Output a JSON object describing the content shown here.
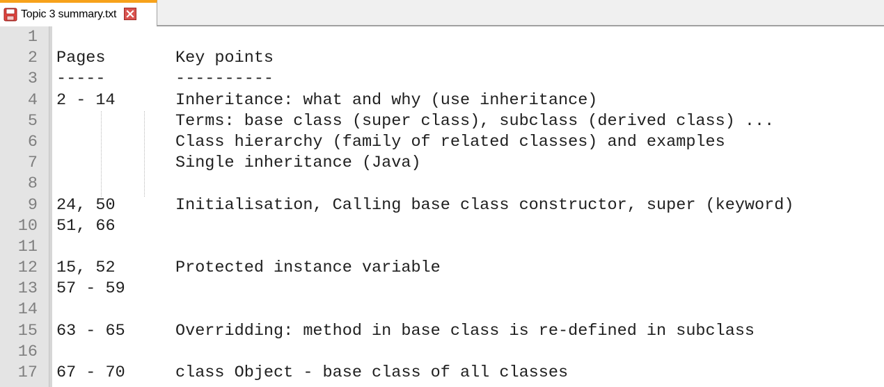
{
  "tab": {
    "title": "Topic 3 summary.txt",
    "icon": "floppy-disk-icon",
    "close_icon": "close-icon",
    "accent_color": "#f7a21b"
  },
  "editor": {
    "lines": [
      {
        "n": "1",
        "pages": "",
        "points": ""
      },
      {
        "n": "2",
        "pages": "Pages",
        "points": "Key points"
      },
      {
        "n": "3",
        "pages": "-----",
        "points": "----------"
      },
      {
        "n": "4",
        "pages": "2 - 14",
        "points": "Inheritance: what and why (use inheritance)"
      },
      {
        "n": "5",
        "pages": "",
        "points": "Terms: base class (super class), subclass (derived class) ..."
      },
      {
        "n": "6",
        "pages": "",
        "points": "Class hierarchy (family of related classes) and examples"
      },
      {
        "n": "7",
        "pages": "",
        "points": "Single inheritance (Java)"
      },
      {
        "n": "8",
        "pages": "",
        "points": ""
      },
      {
        "n": "9",
        "pages": "24, 50",
        "points": "Initialisation, Calling base class constructor, super (keyword)"
      },
      {
        "n": "10",
        "pages": "51, 66",
        "points": ""
      },
      {
        "n": "11",
        "pages": "",
        "points": ""
      },
      {
        "n": "12",
        "pages": "15, 52",
        "points": "Protected instance variable"
      },
      {
        "n": "13",
        "pages": "57 - 59",
        "points": ""
      },
      {
        "n": "14",
        "pages": "",
        "points": ""
      },
      {
        "n": "15",
        "pages": "63 - 65",
        "points": "Overridding: method in base class is re-defined in subclass"
      },
      {
        "n": "16",
        "pages": "",
        "points": ""
      },
      {
        "n": "17",
        "pages": "67 - 70",
        "points": "class Object - base class of all classes"
      }
    ]
  }
}
